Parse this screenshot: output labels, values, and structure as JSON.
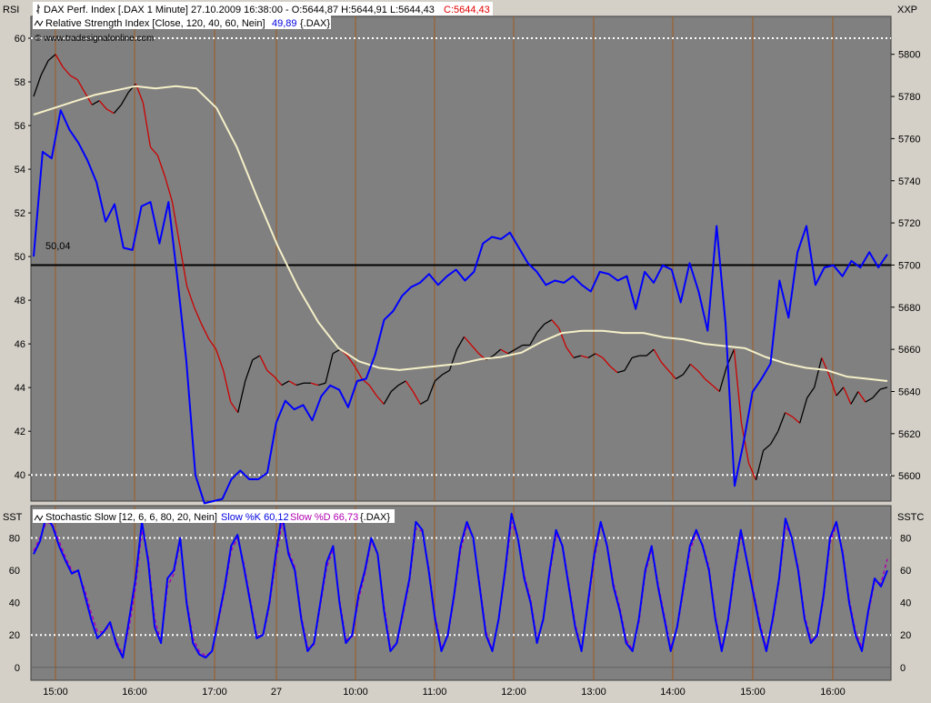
{
  "upper_panel": {
    "left_axis_label": "RSI",
    "right_axis_label": "XXP",
    "legend_line1": {
      "symbol_icon": "price-bars-icon",
      "text": "DAX Perf. Index [.DAX  1 Minute] 27.10.2009 16:38:00 - O:5644,87 H:5644,91 L:5644,43",
      "close_text": "C:5644,43",
      "close_color": "#e00000"
    },
    "legend_line2": {
      "symbol_icon": "line-indicator-icon",
      "text": "Relative Strength Index [Close, 120, 40, 60, Nein]",
      "value_text": "49,89",
      "value_color": "#0000e0",
      "suffix": "{.DAX}"
    },
    "watermark": "© www.tradesignalonline.com",
    "line_label": "50,04",
    "left_ticks": [
      "60",
      "58",
      "56",
      "54",
      "52",
      "50",
      "48",
      "46",
      "44",
      "42",
      "40"
    ],
    "right_ticks": [
      "5800",
      "5780",
      "5760",
      "5740",
      "5720",
      "5700",
      "5680",
      "5660",
      "5640",
      "5620",
      "5600"
    ]
  },
  "lower_panel": {
    "left_axis_label": "SST",
    "right_axis_label": "SSTC",
    "legend": {
      "symbol_icon": "line-indicator-icon",
      "prefix": "Stochastic Slow [12, 6, 6, 80, 20, Nein]",
      "k_text": "Slow %K 60,12",
      "k_color": "#0000e0",
      "d_text": "Slow %D 66,73",
      "d_color": "#b000b0",
      "suffix": "{.DAX}"
    },
    "left_ticks": [
      "80",
      "60",
      "40",
      "20",
      "0"
    ],
    "right_ticks": [
      "80",
      "60",
      "40",
      "20",
      "0"
    ]
  },
  "x_axis": {
    "labels": [
      "15:00",
      "16:00",
      "17:00",
      "27",
      "10:00",
      "11:00",
      "12:00",
      "13:00",
      "14:00",
      "15:00",
      "16:00"
    ]
  },
  "colors": {
    "panel_bg": "#808080",
    "price_up": "#000000",
    "price_down": "#cc0000",
    "rsi_line": "#0000ff",
    "rsi_avg": "#f5f0c8",
    "stoch_k": "#0000ff",
    "stoch_d": "#b000b0",
    "grid_vertical": "#a05a1e",
    "level_lines": "#ffffff"
  },
  "chart_data": [
    {
      "type": "line",
      "title": "DAX Perf. Index [.DAX  1 Minute] 27.10.2009 16:38:00",
      "xlabel": "",
      "ylabel": "XXP",
      "x_labels": [
        "15:00",
        "16:00",
        "17:00",
        "27",
        "10:00",
        "11:00",
        "12:00",
        "13:00",
        "14:00",
        "15:00",
        "16:00"
      ],
      "ylim_price": [
        5588,
        5818
      ],
      "ylim_rsi": [
        38.8,
        61.0
      ],
      "reference_lines_rsi": [
        60,
        40
      ],
      "reference_line_price": 5700,
      "ohlc_last": {
        "open": 5644.87,
        "high": 5644.91,
        "low": 5644.43,
        "close": 5644.43
      },
      "series": [
        {
          "name": "DAX Perf. Index",
          "axis": "right",
          "values": [
            5780,
            5790,
            5797,
            5800,
            5794,
            5790,
            5788,
            5782,
            5776,
            5778,
            5774,
            5772,
            5776,
            5782,
            5786,
            5777,
            5756,
            5752,
            5742,
            5730,
            5710,
            5690,
            5680,
            5672,
            5665,
            5660,
            5650,
            5635,
            5630,
            5645,
            5655,
            5657,
            5650,
            5647,
            5643,
            5645,
            5643,
            5644,
            5644,
            5643,
            5644,
            5658,
            5660,
            5657,
            5652,
            5646,
            5643,
            5638,
            5634,
            5640,
            5643,
            5645,
            5640,
            5634,
            5636,
            5645,
            5648,
            5650,
            5660,
            5666,
            5662,
            5658,
            5655,
            5657,
            5660,
            5658,
            5660,
            5662,
            5662,
            5668,
            5672,
            5674,
            5670,
            5661,
            5656,
            5657,
            5656,
            5658,
            5656,
            5652,
            5649,
            5650,
            5656,
            5657,
            5657,
            5660,
            5654,
            5650,
            5646,
            5648,
            5653,
            5650,
            5646,
            5643,
            5640,
            5652,
            5660,
            5625,
            5606,
            5598,
            5612,
            5615,
            5621,
            5630,
            5628,
            5625,
            5637,
            5642,
            5656,
            5648,
            5638,
            5642,
            5634,
            5640,
            5635,
            5637,
            5641,
            5642
          ]
        },
        {
          "name": "Relative Strength Index",
          "axis": "left",
          "values": [
            50.0,
            54.8,
            54.5,
            56.7,
            55.8,
            55.2,
            54.4,
            53.4,
            51.6,
            52.4,
            50.4,
            50.3,
            52.3,
            52.5,
            50.6,
            52.5,
            49.0,
            45.2,
            40.0,
            38.7,
            38.8,
            38.9,
            39.8,
            40.2,
            39.8,
            39.8,
            40.1,
            42.4,
            43.4,
            43.0,
            43.2,
            42.5,
            43.6,
            44.1,
            43.9,
            43.1,
            44.3,
            44.4,
            45.5,
            47.1,
            47.5,
            48.2,
            48.6,
            48.8,
            49.2,
            48.7,
            49.1,
            49.4,
            48.9,
            49.3,
            50.6,
            50.9,
            50.8,
            51.1,
            50.4,
            49.7,
            49.3,
            48.7,
            48.9,
            48.8,
            49.1,
            48.7,
            48.4,
            49.3,
            49.2,
            48.9,
            49.1,
            47.6,
            49.3,
            48.8,
            49.6,
            49.4,
            47.9,
            49.7,
            48.4,
            46.6,
            51.4,
            46.9,
            39.5,
            41.5,
            43.8,
            44.4,
            45.1,
            48.9,
            47.2,
            50.2,
            51.4,
            48.7,
            49.5,
            49.6,
            49.1,
            49.8,
            49.5,
            50.2,
            49.5,
            50.1
          ]
        },
        {
          "name": "RSI average",
          "axis": "left",
          "values": [
            56.5,
            56.8,
            57.1,
            57.4,
            57.6,
            57.8,
            57.7,
            57.8,
            57.7,
            56.8,
            55.0,
            52.7,
            50.5,
            48.6,
            47.0,
            45.8,
            45.2,
            44.9,
            44.8,
            44.9,
            45.0,
            45.1,
            45.3,
            45.4,
            45.6,
            46.1,
            46.5,
            46.6,
            46.6,
            46.5,
            46.5,
            46.3,
            46.2,
            46.0,
            45.9,
            45.8,
            45.4,
            45.1,
            44.9,
            44.8,
            44.5,
            44.4,
            44.3
          ]
        }
      ]
    },
    {
      "type": "line",
      "title": "Stochastic Slow [12, 6, 6, 80, 20, Nein]",
      "xlabel": "",
      "ylabel": "SST",
      "ylim": [
        -8,
        100
      ],
      "reference_lines": [
        80,
        20
      ],
      "series": [
        {
          "name": "Slow %K",
          "values": [
            70,
            78,
            94,
            87,
            75,
            66,
            58,
            60,
            45,
            30,
            18,
            22,
            28,
            14,
            6,
            30,
            55,
            90,
            65,
            25,
            15,
            55,
            60,
            80,
            40,
            15,
            8,
            6,
            10,
            30,
            50,
            75,
            82,
            62,
            40,
            18,
            20,
            40,
            70,
            95,
            70,
            60,
            30,
            10,
            15,
            40,
            65,
            75,
            40,
            15,
            20,
            45,
            60,
            80,
            70,
            35,
            10,
            15,
            35,
            55,
            90,
            85,
            60,
            30,
            10,
            20,
            45,
            75,
            90,
            80,
            50,
            20,
            10,
            30,
            60,
            95,
            80,
            55,
            40,
            15,
            30,
            60,
            85,
            75,
            50,
            25,
            10,
            40,
            70,
            90,
            75,
            50,
            35,
            15,
            10,
            30,
            60,
            75,
            50,
            30,
            10,
            25,
            50,
            75,
            85,
            75,
            60,
            30,
            10,
            30,
            60,
            85,
            65,
            45,
            25,
            10,
            30,
            55,
            92,
            80,
            60,
            30,
            15,
            20,
            45,
            80,
            90,
            70,
            40,
            20,
            10,
            35,
            55,
            50,
            60
          ]
        },
        {
          "name": "Slow %D",
          "values": [
            72,
            80,
            90,
            88,
            78,
            68,
            60,
            58,
            48,
            34,
            22,
            22,
            26,
            16,
            8,
            25,
            50,
            85,
            68,
            30,
            16,
            50,
            58,
            78,
            42,
            18,
            10,
            7,
            10,
            28,
            48,
            72,
            80,
            64,
            42,
            20,
            19,
            38,
            66,
            90,
            72,
            62,
            32,
            12,
            14,
            38,
            62,
            73,
            42,
            17,
            19,
            42,
            58,
            78,
            70,
            38,
            12,
            14,
            33,
            53,
            86,
            84,
            62,
            32,
            12,
            19,
            43,
            72,
            88,
            80,
            52,
            22,
            11,
            29,
            58,
            90,
            80,
            57,
            42,
            17,
            29,
            58,
            82,
            76,
            52,
            27,
            11,
            38,
            67,
            88,
            76,
            52,
            37,
            17,
            11,
            28,
            58,
            73,
            52,
            32,
            12,
            24,
            48,
            72,
            83,
            76,
            62,
            32,
            12,
            28,
            58,
            82,
            66,
            47,
            27,
            12,
            28,
            53,
            88,
            80,
            62,
            32,
            17,
            19,
            43,
            77,
            88,
            72,
            42,
            22,
            12,
            33,
            53,
            52,
            67
          ]
        }
      ]
    }
  ]
}
